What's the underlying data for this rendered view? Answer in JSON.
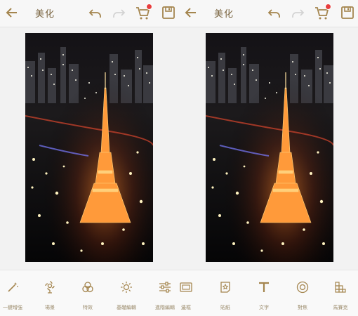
{
  "left_panel": {
    "title": "美化",
    "tools": [
      {
        "label": "一鍵增強",
        "icon": "magic-wand-icon"
      },
      {
        "label": "場景",
        "icon": "scene-flower-icon"
      },
      {
        "label": "特效",
        "icon": "effects-circles-icon"
      },
      {
        "label": "基礎編輯",
        "icon": "sun-adjust-icon"
      },
      {
        "label": "進階編輯",
        "icon": "sliders-icon"
      }
    ]
  },
  "right_panel": {
    "title": "美化",
    "tools": [
      {
        "label": "邊框",
        "icon": "frame-icon"
      },
      {
        "label": "貼紙",
        "icon": "sticker-icon"
      },
      {
        "label": "文字",
        "icon": "text-t-icon"
      },
      {
        "label": "對焦",
        "icon": "focus-circle-icon"
      },
      {
        "label": "馬賽克",
        "icon": "mosaic-icon"
      }
    ]
  },
  "colors": {
    "accent": "#a4854e",
    "badge": "#e83e3e",
    "disabled": "#cfcfcf"
  },
  "photo": {
    "subject": "Tokyo Tower night tilt-shift photo"
  }
}
